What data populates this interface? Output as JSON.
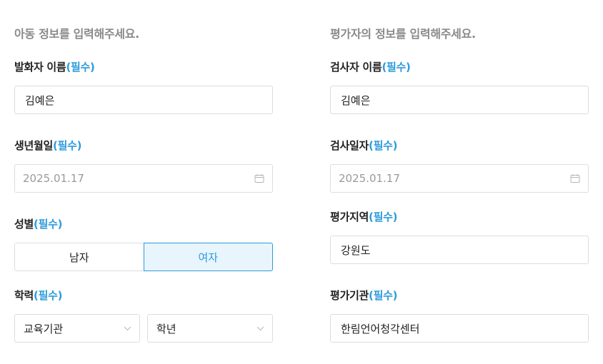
{
  "child": {
    "section_title": "아동 정보를 입력해주세요.",
    "speaker_name": {
      "label": "발화자 이름",
      "required": "(필수)",
      "value": "김예은"
    },
    "birthdate": {
      "label": "생년월일",
      "required": "(필수)",
      "value": "2025.01.17",
      "icon": "calendar-icon"
    },
    "gender": {
      "label": "성별",
      "required": "(필수)",
      "options": [
        "남자",
        "여자"
      ],
      "selected": "여자"
    },
    "education": {
      "label": "학력",
      "required": "(필수)",
      "institution_value": "교육기관",
      "grade_value": "학년",
      "icon": "chevron-down-icon"
    }
  },
  "evaluator": {
    "section_title": "평가자의 정보를 입력해주세요.",
    "examiner_name": {
      "label": "검사자 이름",
      "required": "(필수)",
      "value": "김예은"
    },
    "exam_date": {
      "label": "검사일자",
      "required": "(필수)",
      "value": "2025.01.17",
      "icon": "calendar-icon"
    },
    "region": {
      "label": "평가지역",
      "required": "(필수)",
      "value": "강원도"
    },
    "institution": {
      "label": "평가기관",
      "required": "(필수)",
      "value": "한림언어청각센터"
    }
  },
  "colors": {
    "accent": "#2d9bdb",
    "accent_bg": "#e8f5fd",
    "border": "#dddddd",
    "muted_text": "#8a8a8a"
  }
}
